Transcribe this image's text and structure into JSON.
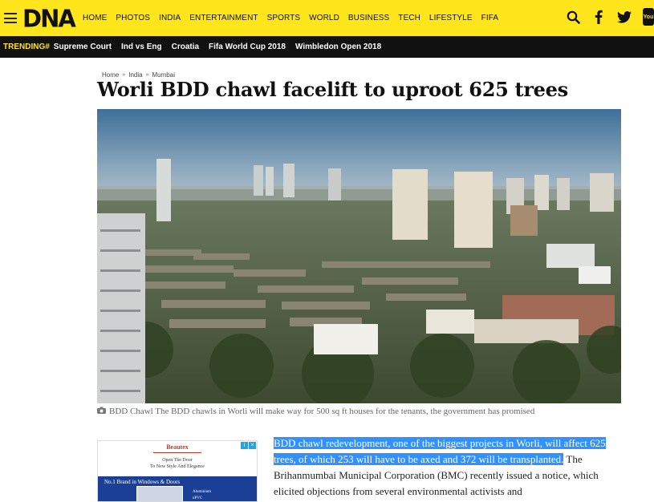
{
  "header": {
    "logo": "DNA",
    "nav": [
      "HOME",
      "PHOTOS",
      "INDIA",
      "ENTERTAINMENT",
      "SPORTS",
      "WORLD",
      "BUSINESS",
      "TECH",
      "LIFESTYLE",
      "FIFA"
    ],
    "youtube_label": "You"
  },
  "trending": {
    "label": "TRENDING#",
    "items": [
      "Supreme Court",
      "Ind vs Eng",
      "Croatia",
      "Fifa World Cup 2018",
      "Wimbledon Open 2018"
    ]
  },
  "article": {
    "breadcrumb": [
      "Home",
      "India",
      "Mumbai"
    ],
    "breadcrumb_sep": "»",
    "title": "Worli BDD chawl facelift to uproot 625 trees",
    "caption": "BDD Chawl The BDD chawls in Worli will make way for 500 sq ft houses for the tenants, the government has promised",
    "para_highlight": "BDD chawl redevelopment, one of the biggest projects in Worli, will affect 625 trees, of which 253 will have to be axed and 372 will be transplanted.",
    "para_rest": "The Brihanmumbai Municipal Corporation (BMC) recently issued a notice, which elicited objections from several environmental activists and"
  },
  "ad": {
    "brand": "Beautex",
    "line1": "Open The Door",
    "line2": "To New Style And Elegance",
    "banner": "No.1 Brand in Windows & Doors",
    "bullets": [
      "Aluminium",
      "uPVC"
    ]
  },
  "colors": {
    "header_bg": "#ffe51c",
    "trend_bg": "#111111",
    "highlight": "#3391ff"
  }
}
